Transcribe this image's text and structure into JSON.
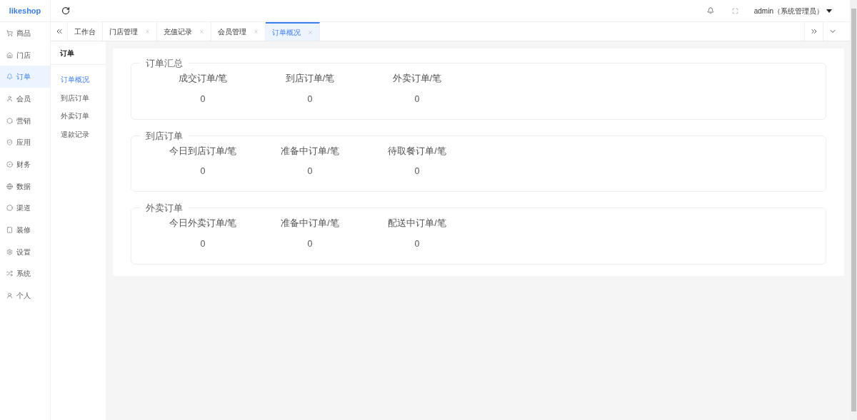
{
  "logo": "likeshop",
  "nav": [
    {
      "label": "商品",
      "selected": false
    },
    {
      "label": "门店",
      "selected": false
    },
    {
      "label": "订单",
      "selected": true
    },
    {
      "label": "会员",
      "selected": false
    },
    {
      "label": "营销",
      "selected": false
    },
    {
      "label": "应用",
      "selected": false
    },
    {
      "label": "财务",
      "selected": false
    },
    {
      "label": "数据",
      "selected": false
    },
    {
      "label": "渠道",
      "selected": false
    },
    {
      "label": "装修",
      "selected": false
    },
    {
      "label": "设置",
      "selected": false
    },
    {
      "label": "系统",
      "selected": false
    },
    {
      "label": "个人",
      "selected": false
    }
  ],
  "header": {
    "user": "admin（系统管理员）"
  },
  "tabs": [
    {
      "label": "工作台",
      "closable": false,
      "selected": false
    },
    {
      "label": "门店管理",
      "closable": true,
      "selected": false
    },
    {
      "label": "充值记录",
      "closable": true,
      "selected": false
    },
    {
      "label": "会员管理",
      "closable": true,
      "selected": false
    },
    {
      "label": "订单概况",
      "closable": true,
      "selected": true
    }
  ],
  "submenu": {
    "title": "订单",
    "items": [
      {
        "label": "订单概况",
        "selected": true
      },
      {
        "label": "到店订单",
        "selected": false
      },
      {
        "label": "外卖订单",
        "selected": false
      },
      {
        "label": "退款记录",
        "selected": false
      }
    ]
  },
  "sections": [
    {
      "title": "订单汇总",
      "stats": [
        {
          "label": "成交订单/笔",
          "value": "0"
        },
        {
          "label": "到店订单/笔",
          "value": "0"
        },
        {
          "label": "外卖订单/笔",
          "value": "0"
        }
      ]
    },
    {
      "title": "到店订单",
      "stats": [
        {
          "label": "今日到店订单/笔",
          "value": "0"
        },
        {
          "label": "准备中订单/笔",
          "value": "0"
        },
        {
          "label": "待取餐订单/笔",
          "value": "0"
        }
      ]
    },
    {
      "title": "外卖订单",
      "stats": [
        {
          "label": "今日外卖订单/笔",
          "value": "0"
        },
        {
          "label": "准备中订单/笔",
          "value": "0"
        },
        {
          "label": "配送中订单/笔",
          "value": "0"
        }
      ]
    }
  ]
}
